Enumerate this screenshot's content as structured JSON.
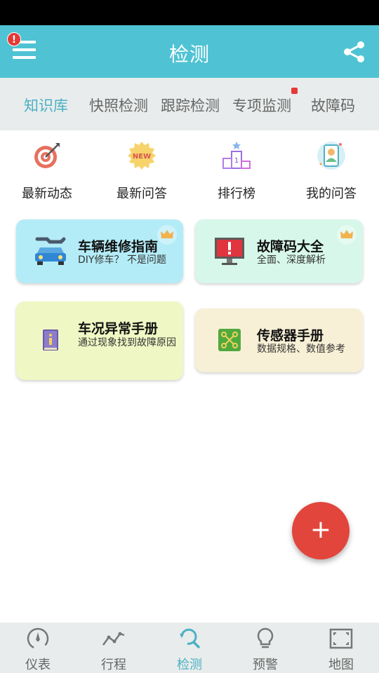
{
  "app_bar": {
    "title": "检测",
    "alert_badge": "!"
  },
  "tabs": [
    {
      "label": "知识库",
      "active": true
    },
    {
      "label": "快照检测",
      "active": false
    },
    {
      "label": "跟踪检测",
      "active": false
    },
    {
      "label": "专项监测",
      "active": false
    },
    {
      "label": "故障码",
      "active": false
    }
  ],
  "quick_links": [
    {
      "label": "最新动态",
      "icon": "target-icon"
    },
    {
      "label": "最新问答",
      "icon": "new-badge-icon"
    },
    {
      "label": "排行榜",
      "icon": "podium-icon"
    },
    {
      "label": "我的问答",
      "icon": "user-card-icon"
    }
  ],
  "cards": [
    {
      "title": "车辆维修指南",
      "subtitle": "DIY修车？ 不是问题",
      "icon": "car-wrench-icon",
      "premium": true
    },
    {
      "title": "故障码大全",
      "subtitle": "全面、深度解析",
      "icon": "monitor-alert-icon",
      "premium": true
    },
    {
      "title": "车况异常手册",
      "subtitle": "通过现象找到故障原因",
      "icon": "info-book-icon",
      "premium": false
    },
    {
      "title": "传感器手册",
      "subtitle": "数据规格、数值参考",
      "icon": "sensor-board-icon",
      "premium": false
    }
  ],
  "fab": {
    "label": "+"
  },
  "bottom_nav": [
    {
      "label": "仪表",
      "icon": "gauge-icon",
      "active": false
    },
    {
      "label": "行程",
      "icon": "trip-line-icon",
      "active": false
    },
    {
      "label": "检测",
      "icon": "search-scan-icon",
      "active": true
    },
    {
      "label": "预警",
      "icon": "lightbulb-icon",
      "active": false
    },
    {
      "label": "地图",
      "icon": "map-frame-icon",
      "active": false
    }
  ],
  "colors": {
    "primary": "#4fc3d3",
    "active_text": "#4ab1c4",
    "fab": "#e2453b",
    "card_blue": "#b3ecf7",
    "card_green": "#d7f7ea",
    "card_yellow": "#eff8c4",
    "card_beige": "#f8f0d6"
  }
}
